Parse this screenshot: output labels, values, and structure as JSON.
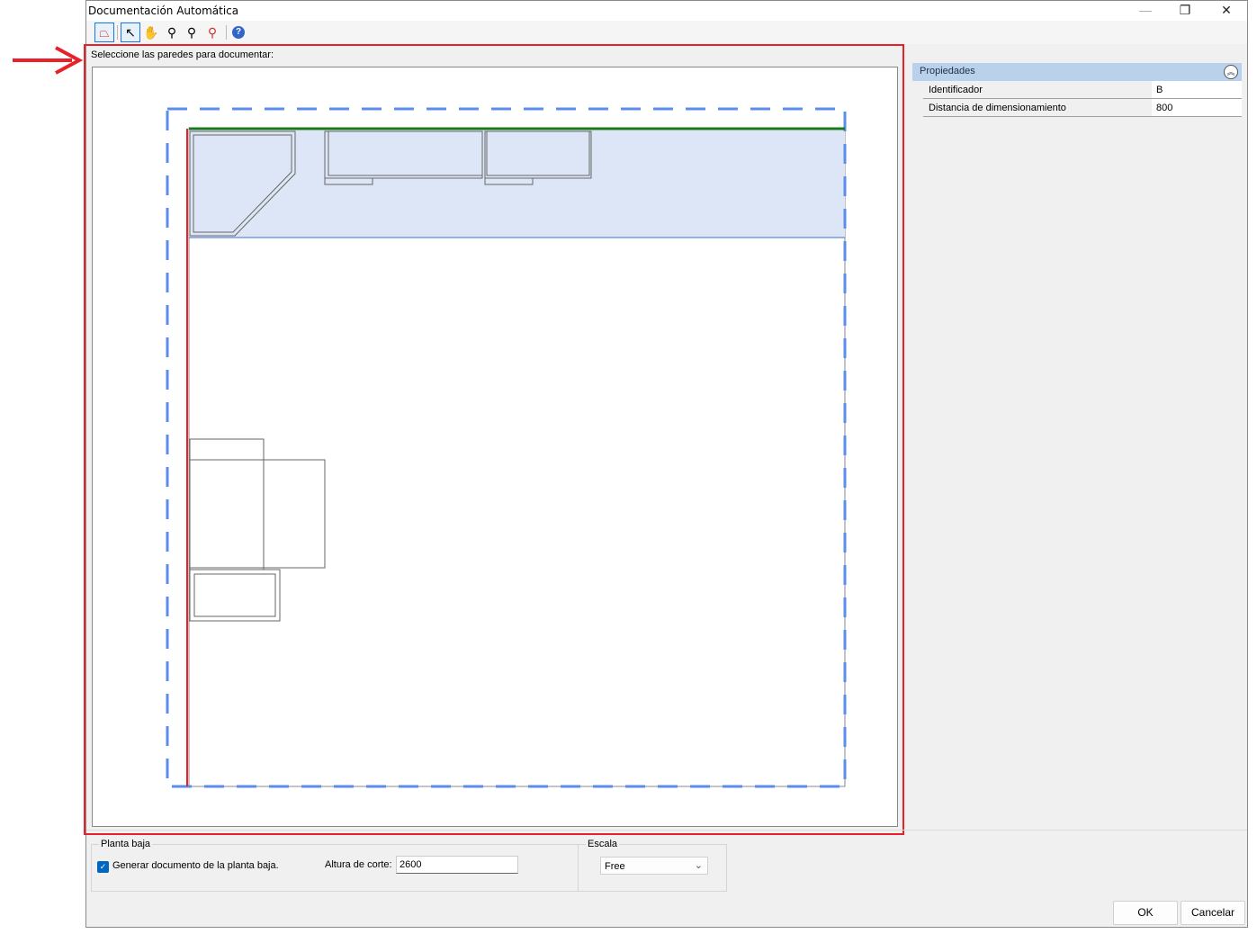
{
  "window": {
    "title": "Documentación Automática",
    "minimize": "—",
    "restore": "❐",
    "close": "✕"
  },
  "toolbar": {
    "items": [
      {
        "name": "wall-select-tool-icon",
        "glyph": "⌂"
      },
      {
        "name": "pointer-icon",
        "glyph": "↖"
      },
      {
        "name": "pan-hand-icon",
        "glyph": "✋"
      },
      {
        "name": "zoom-in-icon",
        "glyph": "🔍"
      },
      {
        "name": "zoom-window-icon",
        "glyph": "🔍"
      },
      {
        "name": "zoom-extents-icon",
        "glyph": "🔍"
      },
      {
        "name": "help-icon",
        "glyph": "?"
      }
    ]
  },
  "prompt": "Seleccione las paredes para documentar:",
  "properties": {
    "title": "Propiedades",
    "rows": [
      {
        "key": "Identificador",
        "value": "B"
      },
      {
        "key": "Distancia de dimensionamiento",
        "value": "800"
      }
    ]
  },
  "ground_floor": {
    "label": "Planta baja",
    "checkbox_label": "Generar documento de la planta baja.",
    "checked": true,
    "cut_height_label": "Altura de corte:",
    "cut_height": "2600"
  },
  "scale": {
    "label": "Escala",
    "value": "Free"
  },
  "buttons": {
    "ok": "OK",
    "cancel": "Cancelar"
  },
  "colors": {
    "selection": "#e8202a",
    "highlight": "#5b8def",
    "selected_wall": "#1a7a1a"
  }
}
